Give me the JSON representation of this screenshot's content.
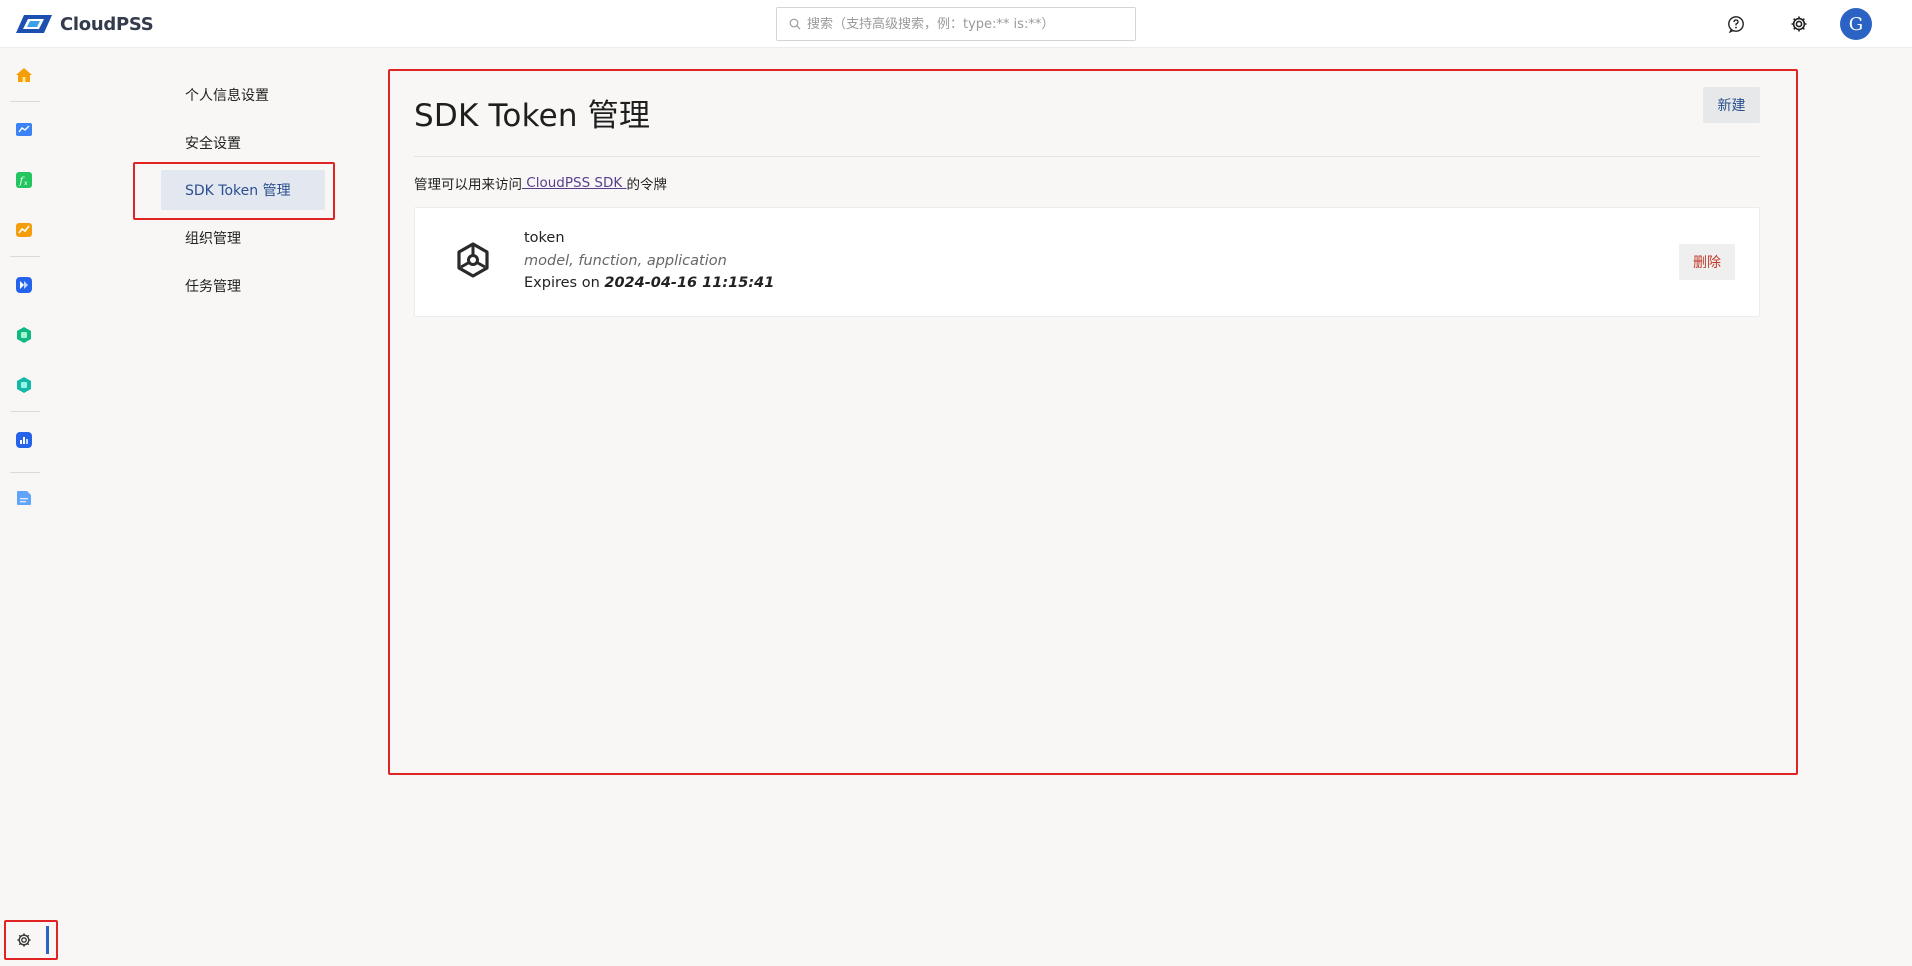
{
  "app": {
    "logo_text": "CloudPSS"
  },
  "search": {
    "placeholder": "搜索（支持高级搜索，例：type:** is:**）"
  },
  "user": {
    "avatar_letter": "G"
  },
  "colors": {
    "accent": "#2b63c5",
    "highlight": "#e02424",
    "danger": "#c0392b"
  },
  "rail": {
    "items": [
      {
        "name": "home",
        "icon": "house-icon",
        "color": "#f59e0b"
      },
      {
        "name": "simstudio",
        "icon": "chart-board-icon",
        "color": "#3b82f6"
      },
      {
        "name": "function",
        "icon": "function-icon",
        "color": "#22c55e"
      },
      {
        "name": "analysis",
        "icon": "line-chart-icon",
        "color": "#f59e0b"
      },
      {
        "name": "power",
        "icon": "power-icon",
        "color": "#2563eb"
      },
      {
        "name": "app1",
        "icon": "hexagon-app-icon",
        "color": "#10b981"
      },
      {
        "name": "app2",
        "icon": "hexagon-app-icon",
        "color": "#14b8a6"
      },
      {
        "name": "dashboard",
        "icon": "dashboard-icon",
        "color": "#2563eb"
      },
      {
        "name": "docs",
        "icon": "document-icon",
        "color": "#60a5fa"
      }
    ],
    "settings_icon": "gear-icon"
  },
  "settings_nav": {
    "items": [
      {
        "label": "个人信息设置"
      },
      {
        "label": "安全设置"
      },
      {
        "label": "SDK Token 管理",
        "active": true
      },
      {
        "label": "组织管理"
      },
      {
        "label": "任务管理"
      }
    ]
  },
  "main": {
    "title": "SDK Token 管理",
    "new_button": "新建",
    "description_prefix": "管理可以用来访问",
    "description_link": " CloudPSS SDK ",
    "description_suffix": "的令牌",
    "tokens": [
      {
        "name": "token",
        "scopes": "model, function, application",
        "expires_prefix": "Expires on ",
        "expires_at": "2024-04-16 11:15:41",
        "delete_button": "删除",
        "icon": "package-hexagon-icon"
      }
    ]
  }
}
